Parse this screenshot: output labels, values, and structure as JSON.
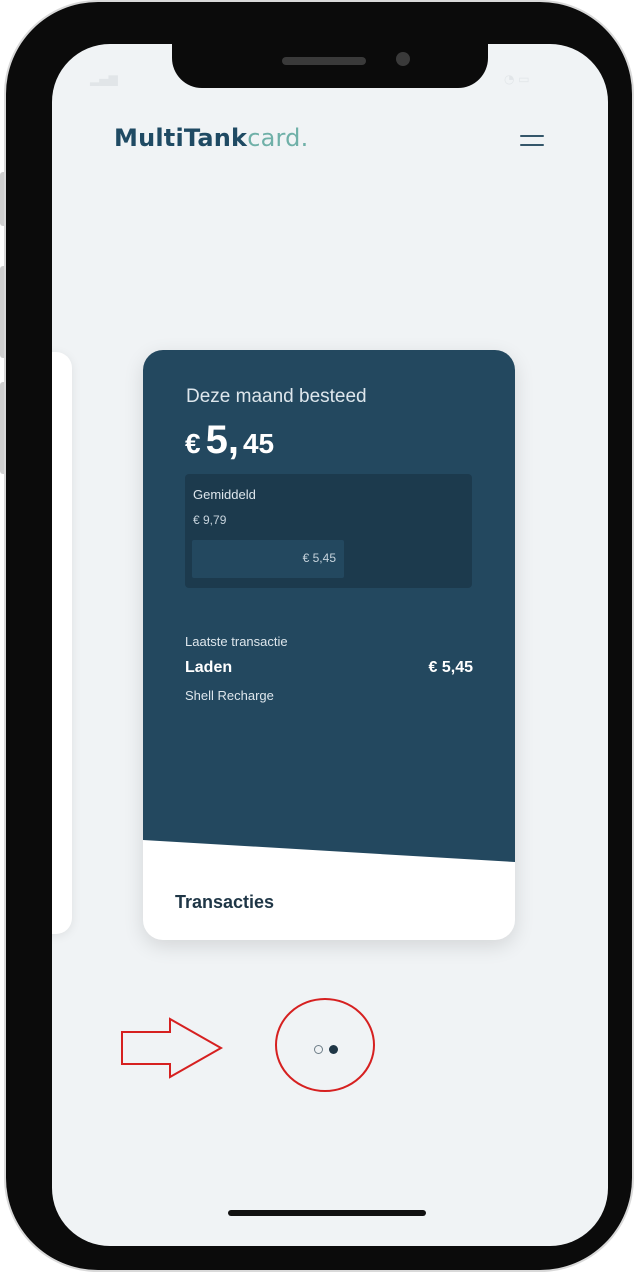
{
  "app": {
    "brand_main": "MultiTank",
    "brand_tail": "card",
    "brand_dot": "."
  },
  "icons": {
    "menu": "hamburger-menu-icon",
    "annotation_arrow": "arrow-right-icon"
  },
  "spending_card": {
    "label": "Deze maand besteed",
    "currency": "€",
    "amount_int": "5,",
    "amount_dec": "45",
    "average": {
      "label": "Gemiddeld",
      "value": "€ 9,79",
      "bar_label": "€ 5,45",
      "bar_fill_fraction": 0.557
    },
    "last_transaction": {
      "caption": "Laatste transactie",
      "title": "Laden",
      "amount": "€ 5,45",
      "subtitle": "Shell Recharge"
    },
    "footer_link": "Transacties"
  },
  "pagination": {
    "count": 2,
    "active_index": 1
  },
  "colors": {
    "card_dark": "#23485f",
    "brand_accent": "#6fb0a8",
    "annotation": "#d62020"
  }
}
